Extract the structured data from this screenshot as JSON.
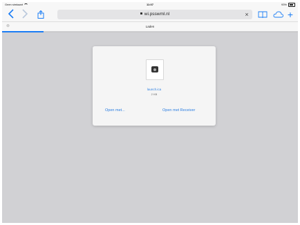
{
  "status": {
    "carrier": "Geen simkaart",
    "time": "11:07",
    "battery": "93%"
  },
  "toolbar": {
    "url": "wi.psswml.nl",
    "close_symbol": "×",
    "plus_symbol": "+",
    "icons": [
      "back-icon",
      "forward-icon",
      "share-icon",
      "lock-icon",
      "close-icon",
      "bookmarks-icon",
      "cloud-icon",
      "plus-icon"
    ]
  },
  "tab": {
    "label": "Laden",
    "close_symbol": "⊗",
    "progress": 0.14
  },
  "card": {
    "file_name": "launch.ica",
    "file_size": "2 KB",
    "open_with": "Open met...",
    "open_receiver": "Open met Receiver"
  },
  "colors": {
    "accent": "#1a7cf5",
    "background": "#d1d1d4"
  }
}
